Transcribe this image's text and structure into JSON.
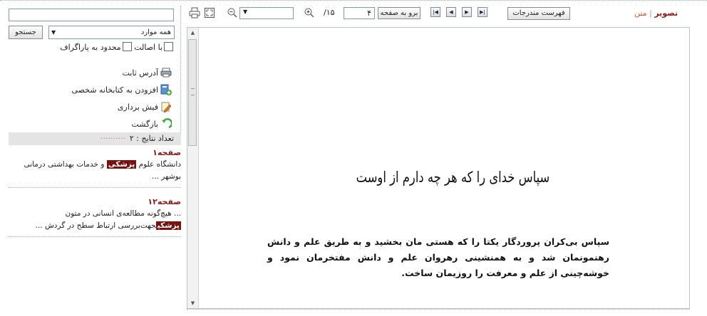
{
  "search": {
    "input_value": "",
    "button_label": "جستجو",
    "scope_value": "همه موارد",
    "option_original": "با اصالت",
    "option_paragraph": "محدود به پاراگراف"
  },
  "actions": [
    {
      "label": "آدرس ثابت",
      "icon": "printer-icon"
    },
    {
      "label": "افزودن به کتابخانه شخصی",
      "icon": "add-library-icon"
    },
    {
      "label": "فیش برداری",
      "icon": "note-pencil-icon"
    },
    {
      "label": "بازگشت",
      "icon": "back-arrow-icon"
    }
  ],
  "results": {
    "count_label": "تعداد نتایج : ۲",
    "items": [
      {
        "title": "صفحه۱",
        "before": "دانشگاه علوم",
        "highlight": "پزشکی",
        "after": "و خدمات بهداشتی درمانی بوشهر ..."
      },
      {
        "title": "صفحه۱۲",
        "line1": "... هیچ‌گونه مطالعه‌ی انسانی در متون",
        "highlight": "پزشکی",
        "after": "جهت‌بررسی ارتباط سطح در گردش ..."
      }
    ]
  },
  "toolbar": {
    "print_icon": "printer-icon",
    "fullscreen_icon": "fullscreen-icon",
    "zoom_out_icon": "zoom-out-icon",
    "zoom_in_icon": "zoom-in-icon",
    "zoom_value": "",
    "total_pages": "/۱۵",
    "current_page": "۴",
    "goto_label": "برو به صفحه",
    "toc_label": "فهرست مندرجات",
    "view_image": "تصویر",
    "view_separator": "|",
    "view_text": "متن"
  },
  "document": {
    "title": "سپاس خدای را که هر چه دارم از اوست",
    "body": "سپاس بی‌کران پروردگار یکتا را که هستی مان بخشید و به طریق علم و دانش رهنمونمان شد و به همنشینی رهروان علم و دانش مفتخرمان نمود و خوشه‌چینی از علم و معرفت را روزیمان ساخت."
  },
  "colors": {
    "accent": "#8b1a1a",
    "highlight_bg": "#7a1111",
    "link_orange": "#c25b2a"
  }
}
